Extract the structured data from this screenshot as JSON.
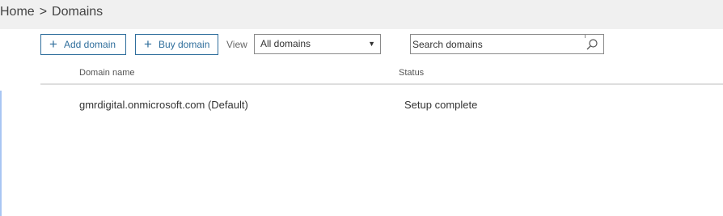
{
  "breadcrumb": {
    "home": "Home",
    "separator": ">",
    "current": "Domains"
  },
  "toolbar": {
    "add_icon": "plus-icon",
    "add_label": "Add domain",
    "buy_icon": "plus-icon",
    "buy_label": "Buy domain",
    "view_label": "View",
    "view_selected": "All domains",
    "search_placeholder": "Search domains",
    "search_icon": "search-icon"
  },
  "table": {
    "columns": [
      "Domain name",
      "Status"
    ],
    "rows": [
      {
        "domain": "gmrdigital.onmicrosoft.com (Default)",
        "status": "Setup complete"
      }
    ]
  },
  "colors": {
    "accent": "#2f6e9c",
    "header_bg": "#f0f0f0",
    "selection_accent": "#a9c6f3"
  }
}
